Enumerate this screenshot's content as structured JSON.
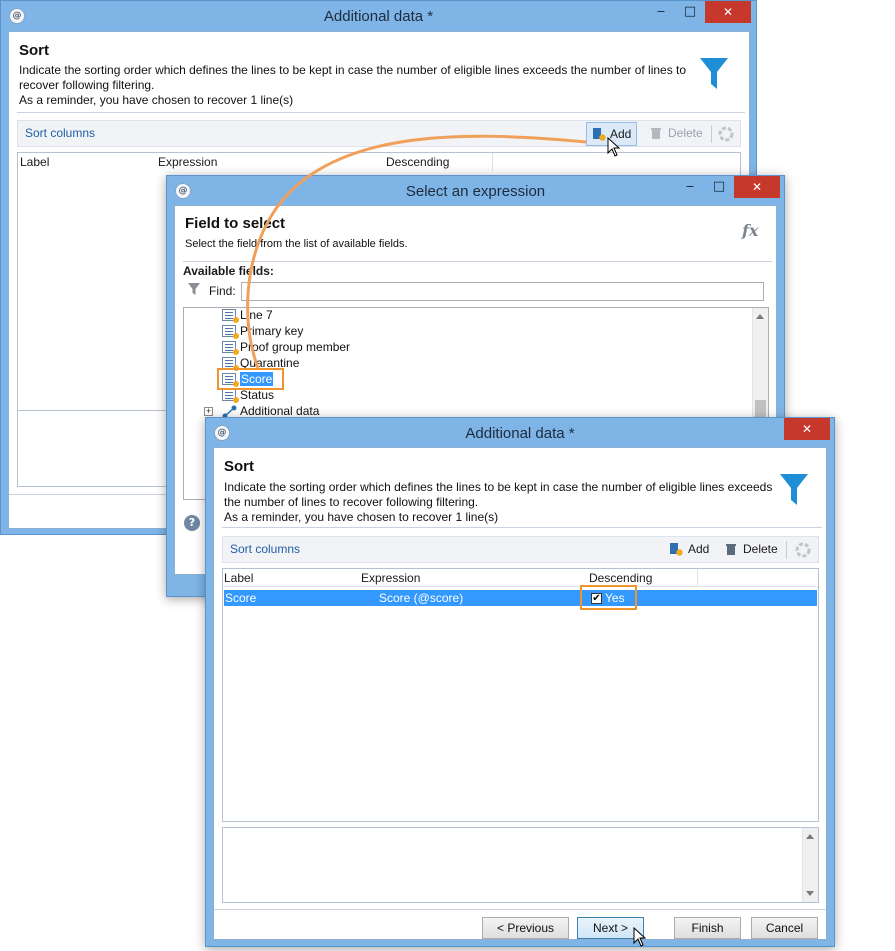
{
  "back_window": {
    "title": "Additional data *",
    "header_title": "Sort",
    "description_line1": "Indicate the sorting order which defines the lines to be kept in case the number of eligible lines exceeds the number of lines to",
    "description_line2": "recover following filtering.",
    "reminder": "As a reminder, you have chosen to recover 1 line(s)",
    "toolbar": {
      "section_label": "Sort columns",
      "add_label": "Add",
      "delete_label": "Delete"
    },
    "columns": [
      "Label",
      "Expression",
      "Descending"
    ]
  },
  "expression_window": {
    "title": "Select an expression",
    "header_title": "Field to select",
    "header_desc": "Select the field from the list of available fields.",
    "fx_label": "fx",
    "available_fields_label": "Available fields:",
    "find_label": "Find:",
    "find_value": "",
    "tree_items": [
      "Line 7",
      "Primary key",
      "Proof group member",
      "Quarantine",
      "Score",
      "Status"
    ],
    "expandable_item": "Additional data",
    "expand_glyph": "+",
    "help_glyph": "?"
  },
  "front_window": {
    "title": "Additional data *",
    "header_title": "Sort",
    "description_line1": "Indicate the sorting order which defines the lines to be kept in case the number of eligible lines exceeds",
    "description_line2": "the number of lines to recover following filtering.",
    "reminder": "As a reminder, you have chosen to recover 1 line(s)",
    "toolbar": {
      "section_label": "Sort columns",
      "add_label": "Add",
      "delete_label": "Delete"
    },
    "columns": [
      "Label",
      "Expression",
      "Descending"
    ],
    "rows": [
      {
        "label": "Score",
        "expression": "Score (@score)",
        "descending": "Yes",
        "descending_checked": true
      }
    ],
    "buttons": {
      "previous": "< Previous",
      "next": "Next >",
      "finish": "Finish",
      "cancel": "Cancel"
    }
  },
  "window_controls": {
    "minimize": "‒",
    "maximize": "□",
    "close": "✕"
  },
  "colors": {
    "accent_orange": "#f0942e",
    "selection_blue": "#3399ff",
    "title_bar": "#7fb4e6",
    "funnel_blue": "#1e8fd6",
    "close_red": "#c7382c"
  },
  "icons": [
    "app-icon",
    "funnel-icon",
    "add-icon",
    "delete-icon",
    "refresh-icon",
    "filter-icon",
    "field-icon",
    "link-icon",
    "help-icon",
    "fx-icon",
    "mouse-cursor"
  ]
}
